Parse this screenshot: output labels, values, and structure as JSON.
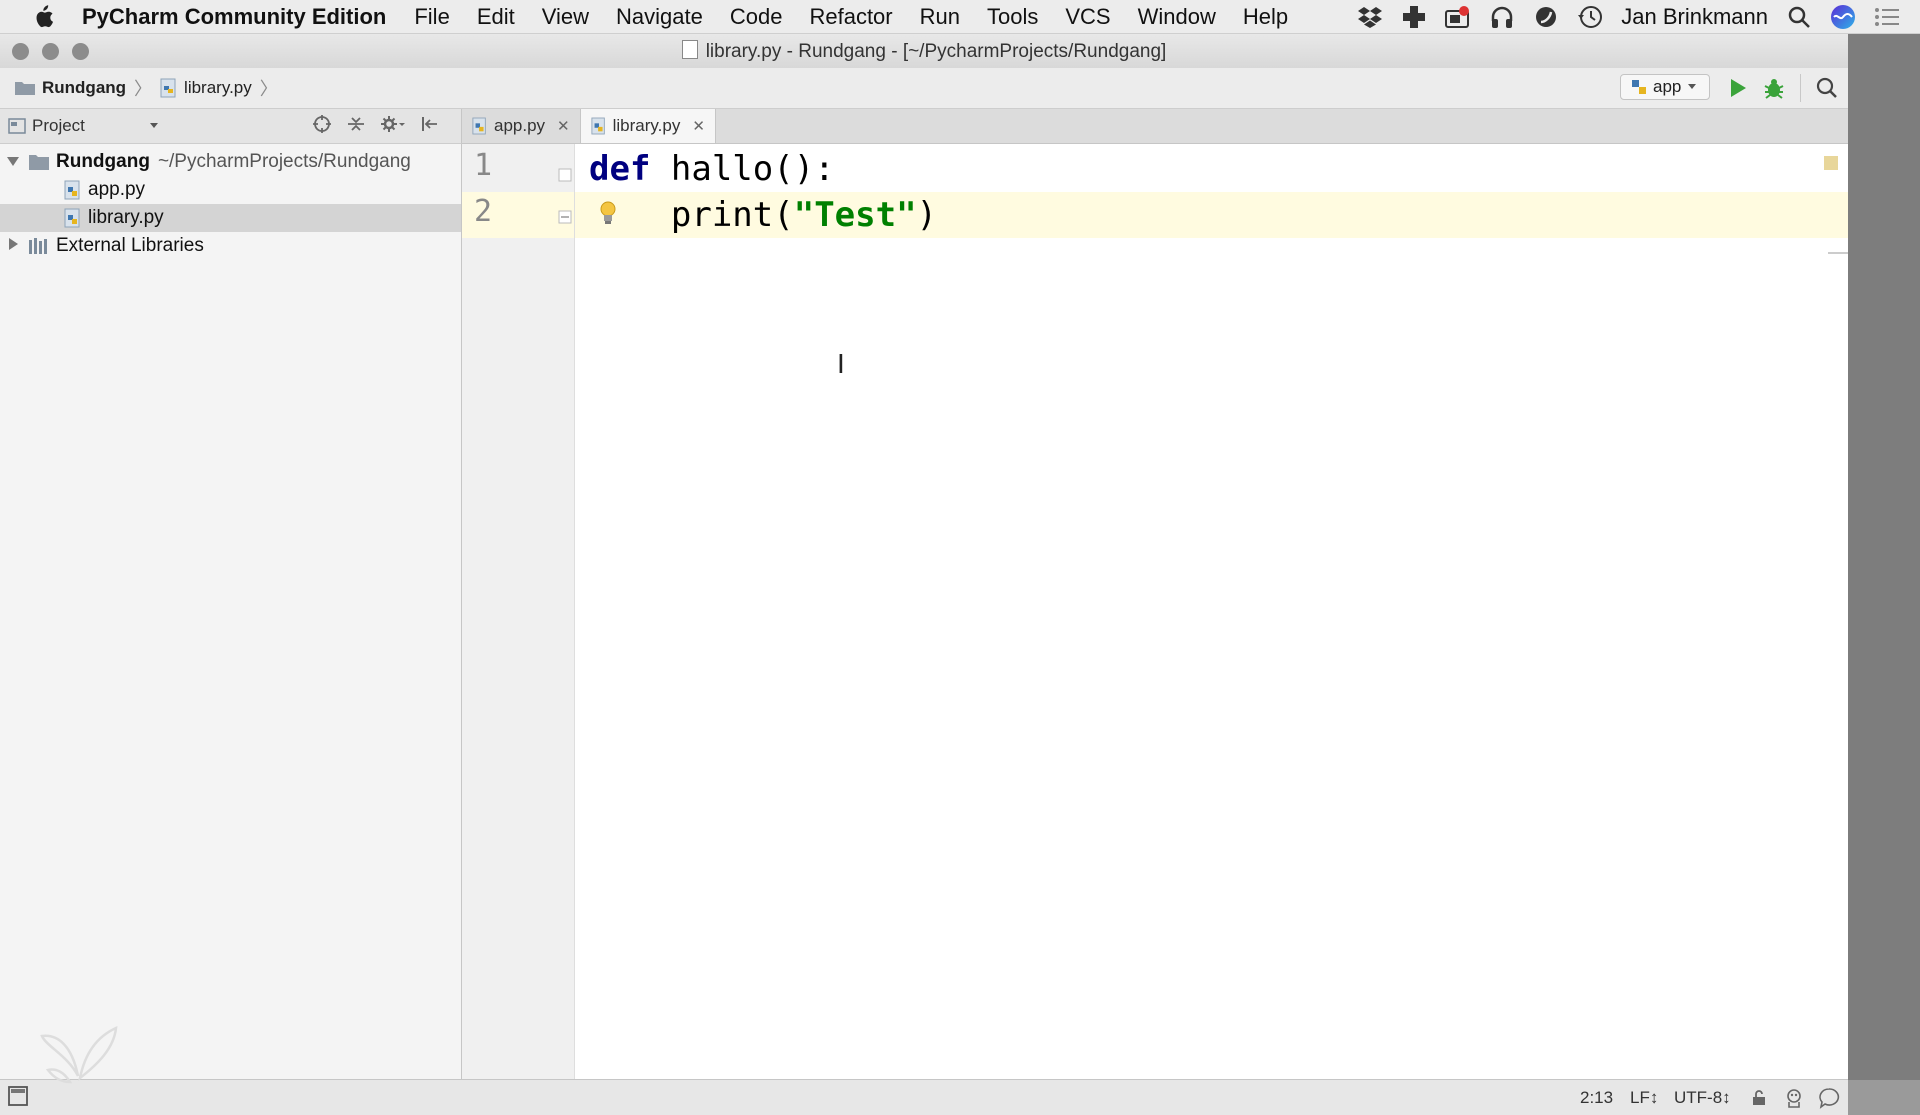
{
  "menubar": {
    "app_name": "PyCharm Community Edition",
    "menus": [
      "File",
      "Edit",
      "View",
      "Navigate",
      "Code",
      "Refactor",
      "Run",
      "Tools",
      "VCS",
      "Window",
      "Help"
    ],
    "user": "Jan Brinkmann"
  },
  "window": {
    "title": "library.py - Rundgang - [~/PycharmProjects/Rundgang]"
  },
  "navbar": {
    "crumbs": [
      "Rundgang",
      "library.py"
    ],
    "run_config": "app"
  },
  "project_panel": {
    "label": "Project",
    "root_name": "Rundgang",
    "root_path": "~/PycharmProjects/Rundgang",
    "files": [
      "app.py",
      "library.py"
    ],
    "external": "External Libraries"
  },
  "tabs": [
    {
      "label": "app.py"
    },
    {
      "label": "library.py"
    }
  ],
  "editor": {
    "line_numbers": [
      "1",
      "2"
    ],
    "line1": {
      "kw": "def",
      "rest": " hallo():"
    },
    "line2": {
      "indent": "    ",
      "func": "print(",
      "str": "\"Test\"",
      "end": ")"
    }
  },
  "status": {
    "position": "2:13",
    "line_sep": "LF↕",
    "encoding": "UTF-8↕"
  },
  "colors": {
    "keyword": "#000080",
    "string": "#008000",
    "current_line": "#fffbe0",
    "selection": "#d4d4d4"
  }
}
